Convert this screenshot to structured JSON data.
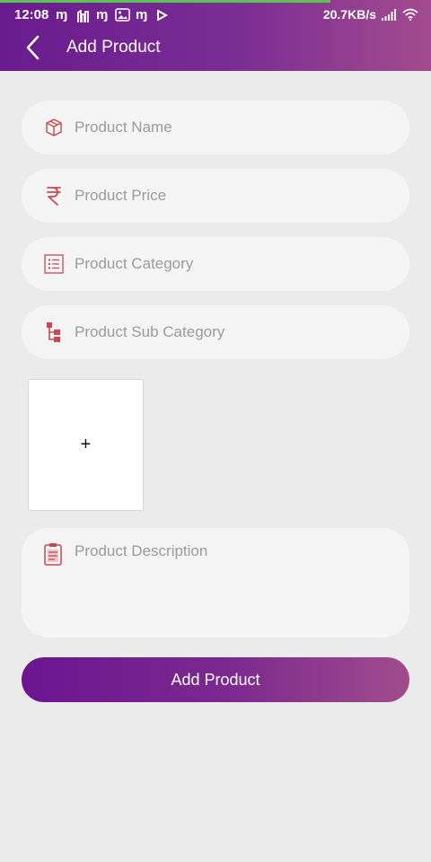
{
  "status_bar": {
    "time": "12:08",
    "network_speed": "20.7KB/s",
    "icons": [
      "notif-m-icon",
      "notif-building-icon",
      "notif-m-icon",
      "notif-photo-icon",
      "notif-m-icon",
      "notif-play-icon",
      "signal-icon",
      "wifi-icon"
    ]
  },
  "header": {
    "title": "Add Product",
    "back_icon": "chevron-left-icon"
  },
  "form": {
    "product_name": {
      "placeholder": "Product Name",
      "icon": "package-icon"
    },
    "product_price": {
      "placeholder": "Product Price",
      "icon": "rupee-icon"
    },
    "product_category": {
      "placeholder": "Product Category",
      "icon": "list-icon"
    },
    "product_sub_category": {
      "placeholder": "Product Sub Category",
      "icon": "hierarchy-icon"
    },
    "image_picker": {
      "label": "+"
    },
    "product_description": {
      "placeholder": "Product Description",
      "icon": "clipboard-icon"
    },
    "submit_label": "Add Product"
  },
  "colors": {
    "accent_start": "#6b1590",
    "accent_end": "#a24c8d",
    "icon_red": "#c8494f",
    "background": "#ebebeb"
  }
}
